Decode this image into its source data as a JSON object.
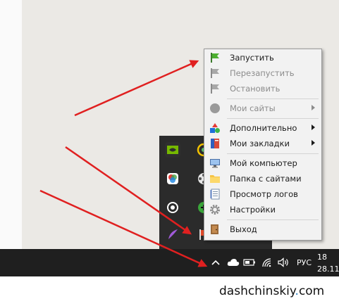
{
  "menu": {
    "items": [
      {
        "label": "Запустить",
        "icon": "green-flag-icon",
        "enabled": true,
        "submenu": false
      },
      {
        "label": "Перезапустить",
        "icon": "gray-flag-icon",
        "enabled": false,
        "submenu": false
      },
      {
        "label": "Остановить",
        "icon": "gray-flag-icon",
        "enabled": false,
        "submenu": false
      },
      {
        "label": "Мои сайты",
        "icon": "gray-circle-icon",
        "enabled": false,
        "submenu": true
      },
      {
        "label": "Дополнительно",
        "icon": "shapes-icon",
        "enabled": true,
        "submenu": true
      },
      {
        "label": "Мои закладки",
        "icon": "bookmarks-book-icon",
        "enabled": true,
        "submenu": true
      },
      {
        "label": "Мой компьютер",
        "icon": "computer-icon",
        "enabled": true,
        "submenu": false
      },
      {
        "label": "Папка с сайтами",
        "icon": "folder-icon",
        "enabled": true,
        "submenu": false
      },
      {
        "label": "Просмотр логов",
        "icon": "log-document-icon",
        "enabled": true,
        "submenu": false
      },
      {
        "label": "Настройки",
        "icon": "gear-icon",
        "enabled": true,
        "submenu": false
      },
      {
        "label": "Выход",
        "icon": "exit-door-icon",
        "enabled": true,
        "submenu": false
      }
    ]
  },
  "taskbar": {
    "language": "РУС",
    "time": "18",
    "date": "28.11"
  },
  "watermark": {
    "left": "dashchinskiy",
    "dot": ".",
    "right": "com"
  },
  "colors": {
    "arrow": "#e02020",
    "taskbar": "#1f1f1f",
    "flyout": "#2b2b2b",
    "menu_bg": "#f2f2f2"
  }
}
